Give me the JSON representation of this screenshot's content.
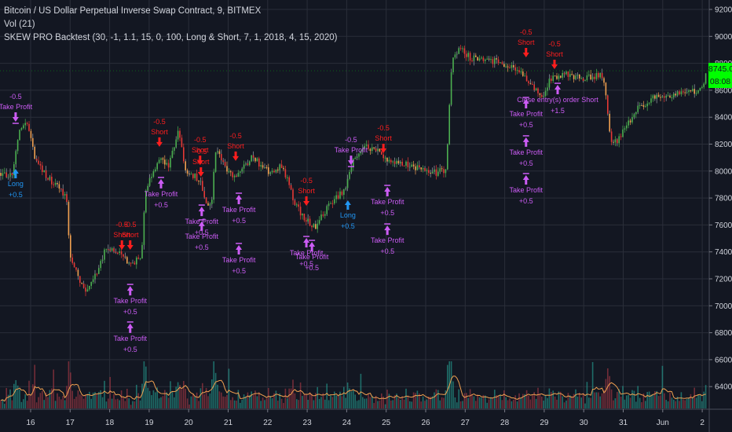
{
  "legend": {
    "symbol": "Bitcoin / US Dollar Perpetual Inverse Swap Contract, 9, BITMEX",
    "volume": "Vol (21)",
    "strategy": "SKEW PRO Backtest (30, -1, 1.1, 15, 0, 100, Long & Short, 7, 1, 2018, 4, 15, 2020)"
  },
  "price_axis": {
    "labels": [
      "9200.0",
      "9000.0",
      "8800.0",
      "8600.0",
      "8400.0",
      "8200.0",
      "8000.0",
      "7800.0",
      "7600.0",
      "7400.0",
      "7200.0",
      "7000.0",
      "6800.0",
      "6600.0",
      "6400.0"
    ],
    "values": [
      9200,
      9000,
      8800,
      8600,
      8400,
      8200,
      8000,
      7800,
      7600,
      7400,
      7200,
      7000,
      6800,
      6600,
      6400
    ]
  },
  "time_axis": {
    "labels": [
      "16",
      "17",
      "18",
      "19",
      "20",
      "21",
      "22",
      "23",
      "24",
      "25",
      "26",
      "27",
      "28",
      "29",
      "30",
      "31",
      "Jun",
      "2"
    ],
    "days": [
      16,
      17,
      18,
      19,
      20,
      21,
      22,
      23,
      24,
      25,
      26,
      27,
      28,
      29,
      30,
      31,
      32,
      33
    ]
  },
  "current_price": {
    "value": 8745.0,
    "label": "8745.0",
    "countdown": "08:08",
    "color": "#00ff00"
  },
  "colors": {
    "background": "#131722",
    "grid": "#2a2e39",
    "up": "#4caf50",
    "down": "#e53935",
    "short": "#ff1e1e",
    "long": "#2196f3",
    "take_profit": "#cc5cf5",
    "volume_ma": "#f0a050"
  },
  "chart_data": {
    "type": "candlestick",
    "title": "Bitcoin / US Dollar Perpetual Inverse Swap Contract, 9, BITMEX",
    "ylim": [
      6400,
      9200
    ],
    "xlabel": "",
    "ylabel": "",
    "path_keypoints": [
      [
        15.22,
        7987
      ],
      [
        15.52,
        7958
      ],
      [
        15.72,
        8308
      ],
      [
        15.92,
        8366
      ],
      [
        16.12,
        8075
      ],
      [
        16.42,
        7958
      ],
      [
        16.82,
        7841
      ],
      [
        16.95,
        7754
      ],
      [
        16.97,
        7404
      ],
      [
        17.11,
        7287
      ],
      [
        17.41,
        7083
      ],
      [
        17.61,
        7200
      ],
      [
        17.91,
        7433
      ],
      [
        18.21,
        7404
      ],
      [
        18.5,
        7317
      ],
      [
        18.8,
        7346
      ],
      [
        18.9,
        7841
      ],
      [
        19.1,
        8016
      ],
      [
        19.3,
        8075
      ],
      [
        19.5,
        8045
      ],
      [
        19.76,
        8308
      ],
      [
        19.9,
        8016
      ],
      [
        20.29,
        7929
      ],
      [
        20.49,
        7725
      ],
      [
        20.59,
        7812
      ],
      [
        20.69,
        8162
      ],
      [
        20.99,
        7987
      ],
      [
        21.19,
        7958
      ],
      [
        21.59,
        8104
      ],
      [
        22.08,
        7987
      ],
      [
        22.38,
        8045
      ],
      [
        22.68,
        7754
      ],
      [
        22.98,
        7637
      ],
      [
        23.18,
        7579
      ],
      [
        23.57,
        7754
      ],
      [
        23.97,
        7871
      ],
      [
        24.17,
        8104
      ],
      [
        24.47,
        8191
      ],
      [
        24.87,
        8133
      ],
      [
        25.07,
        8075
      ],
      [
        25.56,
        8045
      ],
      [
        26.26,
        7987
      ],
      [
        26.52,
        8016
      ],
      [
        26.66,
        8803
      ],
      [
        26.86,
        8920
      ],
      [
        27.15,
        8833
      ],
      [
        27.55,
        8833
      ],
      [
        28.15,
        8774
      ],
      [
        28.54,
        8687
      ],
      [
        28.94,
        8541
      ],
      [
        29.14,
        8687
      ],
      [
        29.54,
        8716
      ],
      [
        29.94,
        8687
      ],
      [
        30.43,
        8716
      ],
      [
        30.53,
        8658
      ],
      [
        30.69,
        8191
      ],
      [
        30.83,
        8220
      ],
      [
        31.03,
        8308
      ],
      [
        31.33,
        8454
      ],
      [
        31.73,
        8541
      ],
      [
        32.32,
        8570
      ],
      [
        33.02,
        8611
      ],
      [
        33.12,
        8745
      ]
    ],
    "markers": [
      {
        "day": 15.62,
        "price": 8366,
        "dir": "down",
        "kind": "take_profit",
        "label": "Take Profit",
        "qty": "-0.5"
      },
      {
        "day": 15.62,
        "price": 8016,
        "dir": "up",
        "kind": "long",
        "label": "Long",
        "qty": "+0.5"
      },
      {
        "day": 18.31,
        "price": 7416,
        "dir": "down",
        "kind": "short",
        "label": "Short",
        "qty": "-0.5"
      },
      {
        "day": 18.52,
        "price": 7416,
        "dir": "down",
        "kind": "short",
        "label": "Short",
        "qty": "-0.5"
      },
      {
        "day": 18.52,
        "price": 7147,
        "dir": "up",
        "kind": "take_profit",
        "label": "Take Profit",
        "qty": "+0.5"
      },
      {
        "day": 18.52,
        "price": 6868,
        "dir": "up",
        "kind": "take_profit",
        "label": "Take Profit",
        "qty": "+0.5"
      },
      {
        "day": 19.26,
        "price": 8180,
        "dir": "down",
        "kind": "short",
        "label": "Short",
        "qty": "-0.5"
      },
      {
        "day": 19.3,
        "price": 7941,
        "dir": "up",
        "kind": "take_profit",
        "label": "Take Profit",
        "qty": "+0.5"
      },
      {
        "day": 20.29,
        "price": 8045,
        "dir": "down",
        "kind": "short",
        "label": "Short",
        "qty": "-0.5"
      },
      {
        "day": 20.31,
        "price": 7958,
        "dir": "down",
        "kind": "short",
        "label": "Short",
        "qty": "-0.5"
      },
      {
        "day": 20.33,
        "price": 7736,
        "dir": "up",
        "kind": "take_profit",
        "label": "Take Profit",
        "qty": "+0.5"
      },
      {
        "day": 20.33,
        "price": 7626,
        "dir": "up",
        "kind": "take_profit",
        "label": "Take Profit",
        "qty": "+0.5"
      },
      {
        "day": 21.19,
        "price": 8075,
        "dir": "down",
        "kind": "short",
        "label": "Short",
        "qty": "-0.5"
      },
      {
        "day": 21.27,
        "price": 7824,
        "dir": "up",
        "kind": "take_profit",
        "label": "Take Profit",
        "qty": "+0.5"
      },
      {
        "day": 21.27,
        "price": 7451,
        "dir": "up",
        "kind": "take_profit",
        "label": "Take Profit",
        "qty": "+0.5"
      },
      {
        "day": 22.98,
        "price": 7742,
        "dir": "down",
        "kind": "short",
        "label": "Short",
        "qty": "-0.5"
      },
      {
        "day": 22.98,
        "price": 7503,
        "dir": "up",
        "kind": "take_profit",
        "label": "Take Profit",
        "qty": "+0.5"
      },
      {
        "day": 23.12,
        "price": 7474,
        "dir": "up",
        "kind": "take_profit",
        "label": "Take Profit",
        "qty": "+0.5"
      },
      {
        "day": 24.03,
        "price": 7783,
        "dir": "up",
        "kind": "long",
        "label": "Long",
        "qty": "+0.5"
      },
      {
        "day": 24.11,
        "price": 8045,
        "dir": "down",
        "kind": "take_profit",
        "label": "Take Profit",
        "qty": "-0.5"
      },
      {
        "day": 24.93,
        "price": 8133,
        "dir": "down",
        "kind": "short",
        "label": "Short",
        "qty": "-0.5"
      },
      {
        "day": 25.03,
        "price": 7882,
        "dir": "up",
        "kind": "take_profit",
        "label": "Take Profit",
        "qty": "+0.5"
      },
      {
        "day": 25.03,
        "price": 7596,
        "dir": "up",
        "kind": "take_profit",
        "label": "Take Profit",
        "qty": "+0.5"
      },
      {
        "day": 28.54,
        "price": 8844,
        "dir": "down",
        "kind": "short",
        "label": "Short",
        "qty": "-0.5"
      },
      {
        "day": 29.26,
        "price": 8757,
        "dir": "down",
        "kind": "short",
        "label": "Short",
        "qty": "-0.5"
      },
      {
        "day": 28.54,
        "price": 8535,
        "dir": "up",
        "kind": "take_profit",
        "label": "Take Profit",
        "qty": "+0.5"
      },
      {
        "day": 28.54,
        "price": 8250,
        "dir": "up",
        "kind": "take_profit",
        "label": "Take Profit",
        "qty": "+0.5"
      },
      {
        "day": 28.54,
        "price": 7970,
        "dir": "up",
        "kind": "take_profit",
        "label": "Take Profit",
        "qty": "+0.5"
      },
      {
        "day": 29.34,
        "price": 8640,
        "dir": "up",
        "kind": "take_profit",
        "label": "Close entry(s) order Short",
        "qty": "+1.5"
      }
    ]
  }
}
